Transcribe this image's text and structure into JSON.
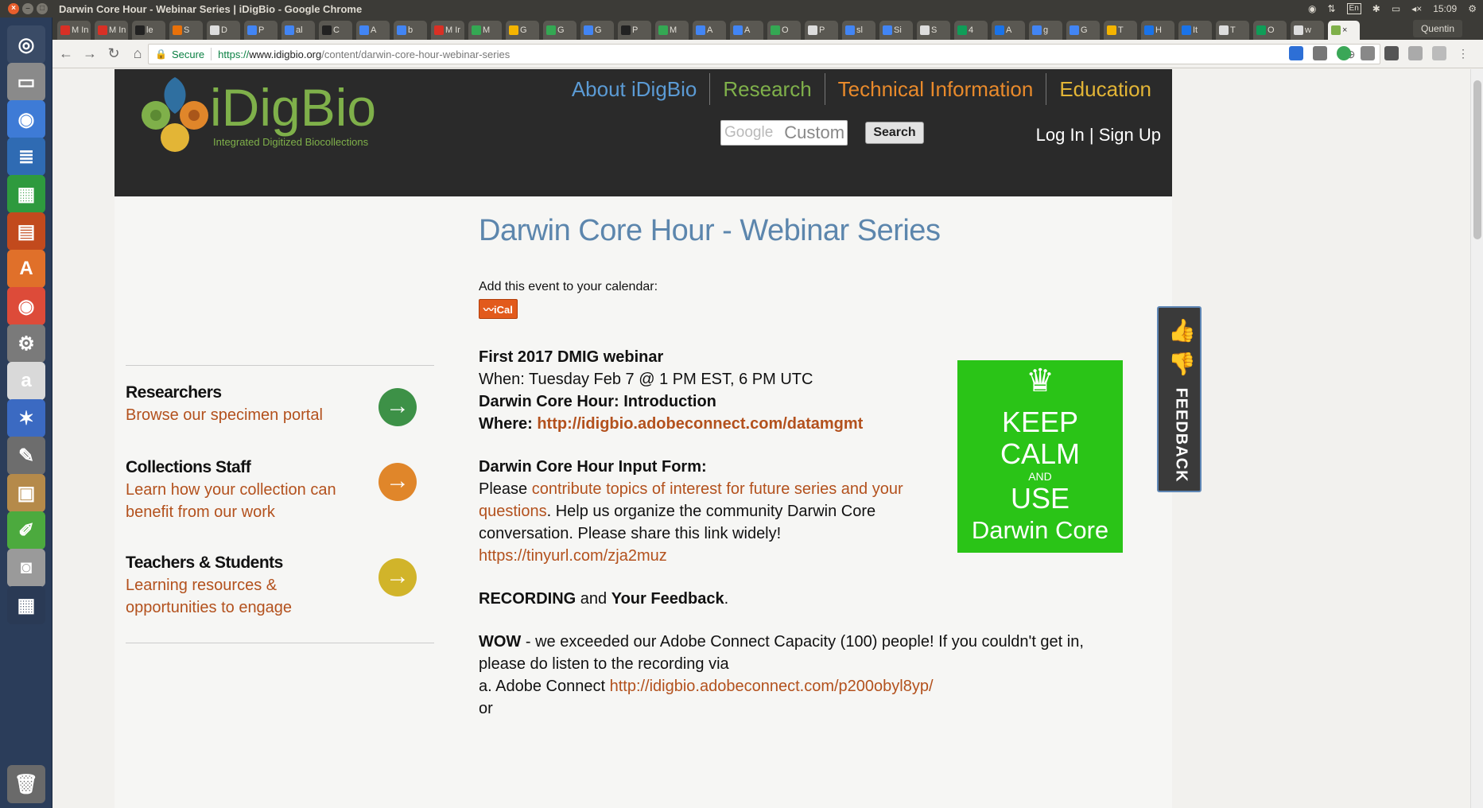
{
  "os": {
    "window_title": "Darwin Core Hour - Webinar Series | iDigBio - Google Chrome",
    "window_buttons": [
      "×",
      "–",
      "□"
    ],
    "clock": "15:09",
    "keyboard_layout": "En",
    "user": "Quentin"
  },
  "launcher": {
    "items": [
      {
        "name": "dash-home-icon",
        "glyph": "◎",
        "color": "#3a4b66"
      },
      {
        "name": "files-icon",
        "glyph": "▭",
        "color": "#8a8a8a"
      },
      {
        "name": "chromium-icon",
        "glyph": "◉",
        "color": "#3e7bd6"
      },
      {
        "name": "writer-icon",
        "glyph": "≣",
        "color": "#2f6bb3"
      },
      {
        "name": "calc-icon",
        "glyph": "▦",
        "color": "#2e9a3e"
      },
      {
        "name": "impress-icon",
        "glyph": "▤",
        "color": "#c24a1d"
      },
      {
        "name": "software-center-icon",
        "glyph": "A",
        "color": "#e0702a"
      },
      {
        "name": "chrome-icon",
        "glyph": "◉",
        "color": "#dd4b39"
      },
      {
        "name": "settings-icon",
        "glyph": "⚙",
        "color": "#7a7a7a"
      },
      {
        "name": "amazon-icon",
        "glyph": "a",
        "color": "#d9d9d9"
      },
      {
        "name": "xmind-icon",
        "glyph": "✶",
        "color": "#3b6ac2"
      },
      {
        "name": "gimp-icon",
        "glyph": "✎",
        "color": "#6d6d6d"
      },
      {
        "name": "archive-icon",
        "glyph": "▣",
        "color": "#b58a4a"
      },
      {
        "name": "editor-icon",
        "glyph": "✐",
        "color": "#4caa3e"
      },
      {
        "name": "camera-icon",
        "glyph": "◙",
        "color": "#9a9a9a"
      },
      {
        "name": "workspace-icon",
        "glyph": "▦",
        "color": "#2a3a55"
      },
      {
        "name": "trash-icon",
        "glyph": "🗑",
        "color": "#6a6a6a"
      }
    ]
  },
  "browser": {
    "tabs": [
      {
        "label": "M In",
        "color": "#d93025"
      },
      {
        "label": "M In",
        "color": "#d93025"
      },
      {
        "label": "le",
        "color": "#222"
      },
      {
        "label": "S",
        "color": "#e8710a"
      },
      {
        "label": "D",
        "color": "#ddd"
      },
      {
        "label": "P",
        "color": "#4285f4"
      },
      {
        "label": "al",
        "color": "#4285f4"
      },
      {
        "label": "C",
        "color": "#222"
      },
      {
        "label": "A",
        "color": "#4285f4"
      },
      {
        "label": "b",
        "color": "#4285f4"
      },
      {
        "label": "M Ir",
        "color": "#d93025"
      },
      {
        "label": "M",
        "color": "#34a853"
      },
      {
        "label": "G",
        "color": "#f4b400"
      },
      {
        "label": "G",
        "color": "#34a853"
      },
      {
        "label": "G",
        "color": "#4285f4"
      },
      {
        "label": "P",
        "color": "#222"
      },
      {
        "label": "M",
        "color": "#34a853"
      },
      {
        "label": "A",
        "color": "#4285f4"
      },
      {
        "label": "A",
        "color": "#4285f4"
      },
      {
        "label": "O",
        "color": "#34a853"
      },
      {
        "label": "P",
        "color": "#ddd"
      },
      {
        "label": "sl",
        "color": "#4285f4"
      },
      {
        "label": "Si",
        "color": "#4285f4"
      },
      {
        "label": "S",
        "color": "#ddd"
      },
      {
        "label": "4",
        "color": "#0f9d58"
      },
      {
        "label": "A",
        "color": "#1a73e8"
      },
      {
        "label": "g",
        "color": "#4285f4"
      },
      {
        "label": "G",
        "color": "#4285f4"
      },
      {
        "label": "T",
        "color": "#f4b400"
      },
      {
        "label": "H",
        "color": "#1a73e8"
      },
      {
        "label": "It",
        "color": "#1a73e8"
      },
      {
        "label": "T",
        "color": "#ddd"
      },
      {
        "label": "O",
        "color": "#0f9d58"
      },
      {
        "label": "w",
        "color": "#ddd"
      },
      {
        "label": "×",
        "color": "#7fb04a"
      }
    ],
    "url_secure": "Secure",
    "url_scheme": "https://",
    "url_host": "www.idigbio.org",
    "url_path": "/content/darwin-core-hour-webinar-series"
  },
  "site": {
    "logo_text": "iDigBio",
    "logo_tagline": "Integrated Digitized Biocollections",
    "nav": [
      {
        "label": "About iDigBio",
        "color": "#5b9bd5"
      },
      {
        "label": "Research",
        "color": "#7fb04a"
      },
      {
        "label": "Technical Information",
        "color": "#e98a2b"
      },
      {
        "label": "Education",
        "color": "#e3b536"
      }
    ],
    "search_brand": "Google",
    "search_placeholder": "Custom Search",
    "search_button": "Search",
    "auth": "Log In | Sign Up"
  },
  "sidebar": {
    "items": [
      {
        "title": "Researchers",
        "text": "Browse our specimen portal",
        "arrow_color": "#3d9147"
      },
      {
        "title": "Collections Staff",
        "text": "Learn how your collection can benefit from our work",
        "arrow_color": "#e0862a"
      },
      {
        "title": "Teachers & Students",
        "text": "Learning resources & opportunities to engage",
        "arrow_color": "#d1b42a"
      }
    ]
  },
  "article": {
    "title": "Darwin Core Hour - Webinar Series",
    "calendar_label": "Add this event to your calendar:",
    "ical": "iCal",
    "event_title": "First 2017 DMIG webinar",
    "when": "When: Tuesday Feb 7 @ 1 PM EST, 6 PM UTC",
    "hour_title": "Darwin Core Hour: Introduction",
    "where_label": "Where: ",
    "where_link": "http://idigbio.adobeconnect.com/datamgmt",
    "form_title": "Darwin Core Hour Input Form:",
    "form_please": "Please ",
    "form_link_1": "contribute topics of interest for future series and your",
    "form_link_2": "questions",
    "form_rest": ". Help us organize the community Darwin Core",
    "form_rest_2": "conversation. Please share this link widely!",
    "form_short_link": "https://tinyurl.com/zja2muz",
    "recording": "RECORDING",
    "and": " and ",
    "your_feedback": "Your Feedback",
    "period": ".",
    "wow": "WOW",
    "wow_text": " - we exceeded our Adobe Connect Capacity (100) people!  If you couldn't get in,",
    "wow_text_2": "please do listen to the recording via",
    "option_a": "a. Adobe Connect ",
    "option_a_link": "http://idigbio.adobeconnect.com/p200obyl8yp/",
    "or": "or",
    "poster": {
      "line1": "KEEP",
      "line2": "CALM",
      "line3": "AND",
      "line4": "USE",
      "line5": "Darwin Core"
    }
  },
  "feedback": {
    "label": "FEEDBACK"
  }
}
